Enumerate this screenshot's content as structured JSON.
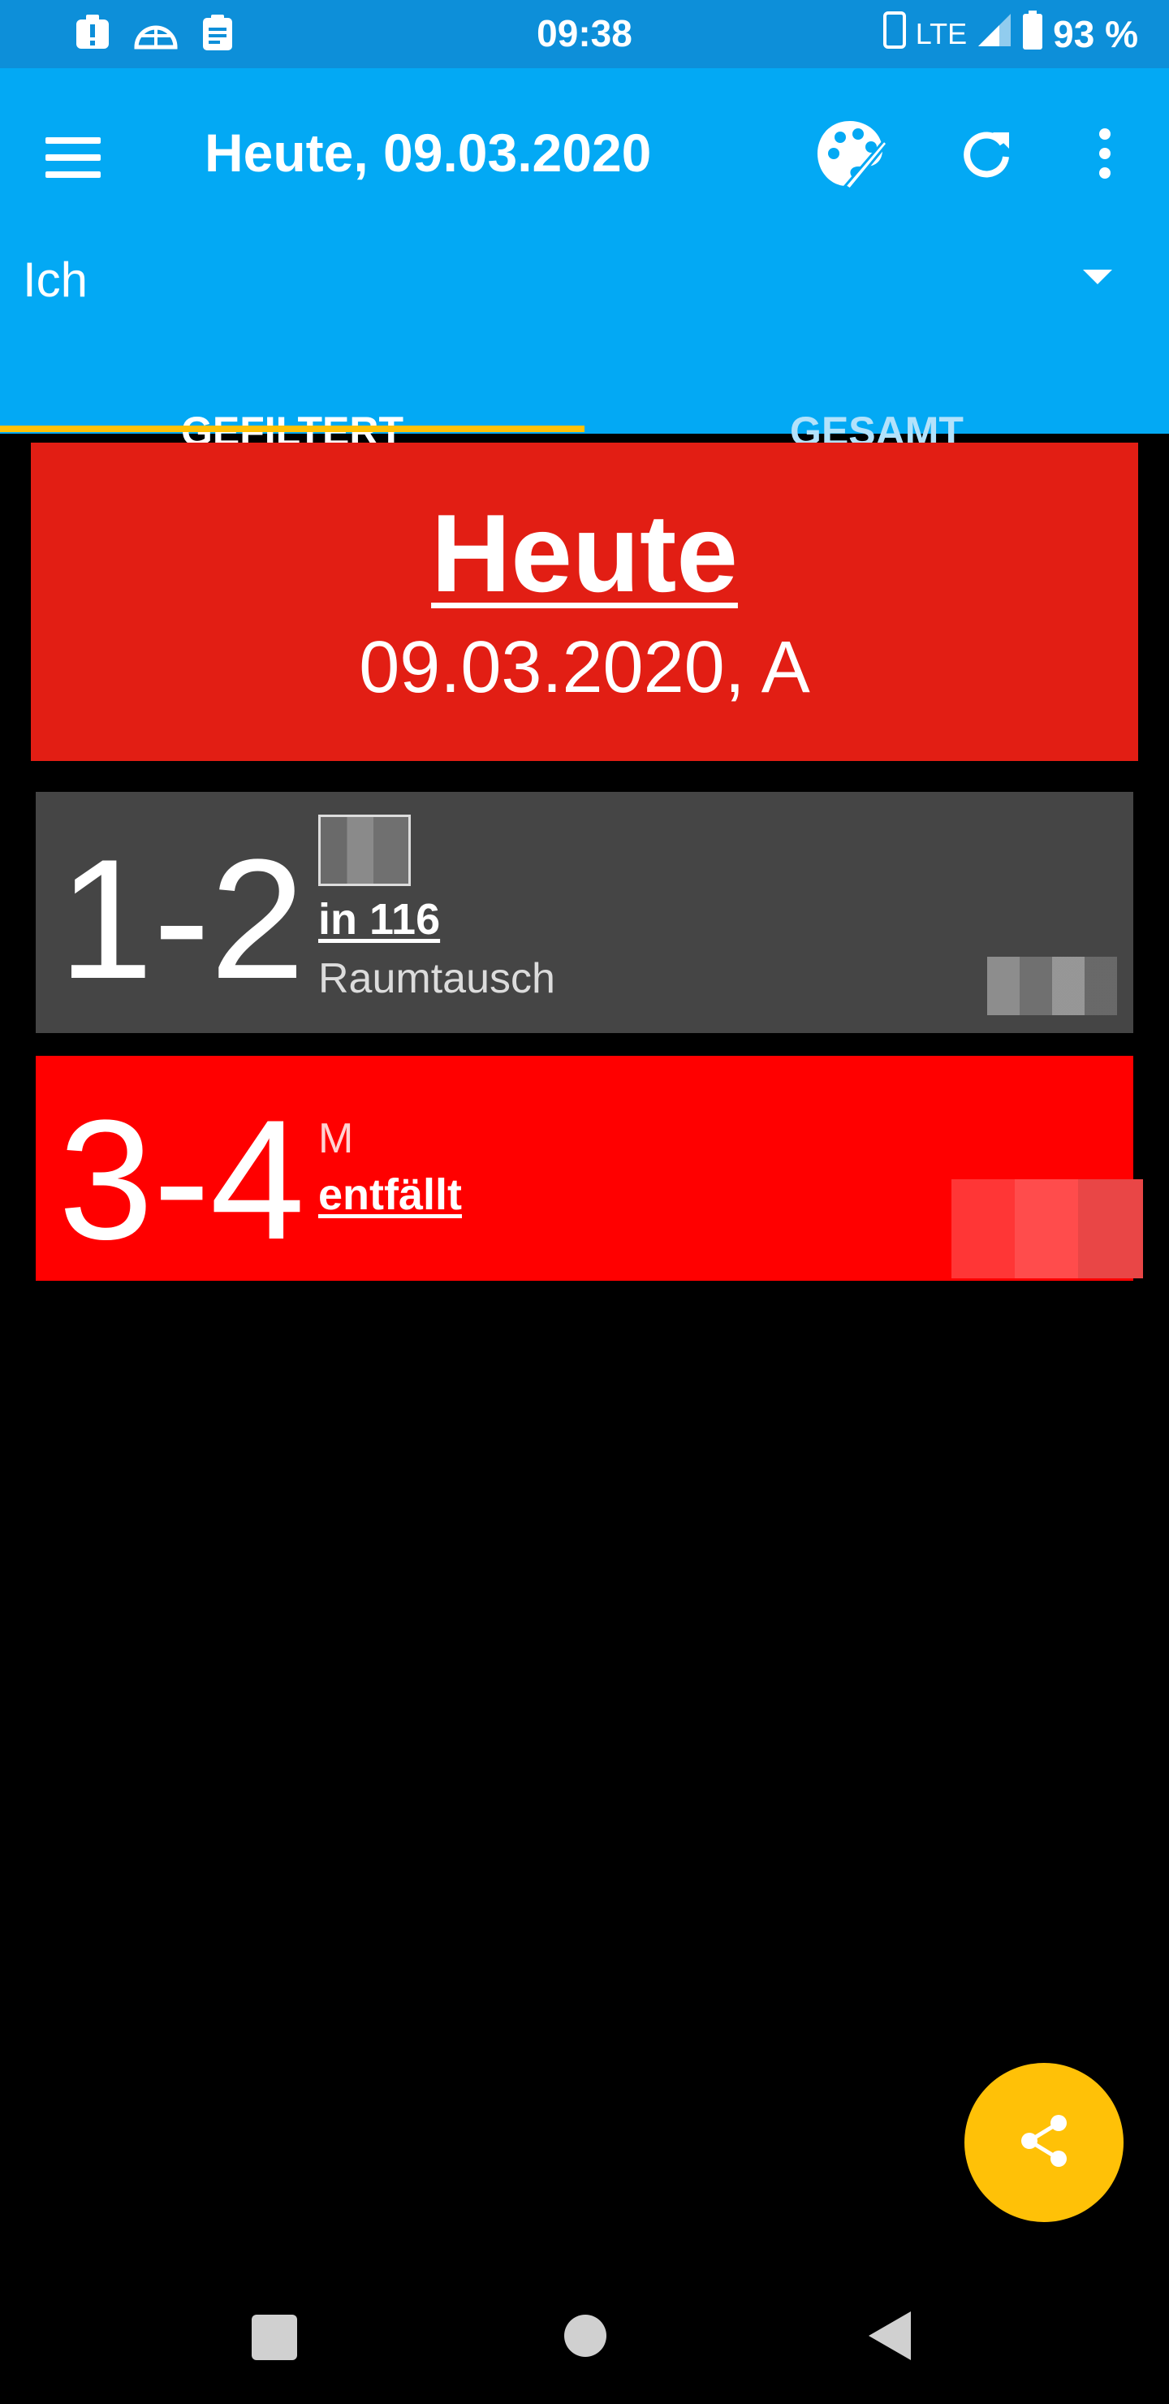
{
  "status_bar": {
    "time": "09:38",
    "network": "LTE",
    "battery": "93 %",
    "icons": [
      "alert-icon",
      "dome-icon",
      "clipboard-icon",
      "phone-icon",
      "signal-icon",
      "battery-icon"
    ]
  },
  "app_bar": {
    "title": "Heute, 09.03.2020",
    "actions": [
      "palette-icon",
      "refresh-icon",
      "more-vert-icon"
    ],
    "dropdown_value": "Ich",
    "tabs": [
      {
        "label": "GEFILTERT",
        "active": true
      },
      {
        "label": "GESAMT",
        "active": false
      }
    ]
  },
  "day": {
    "title": "Heute",
    "date": "09.03.2020, A",
    "color": "#e21e14"
  },
  "lessons": [
    {
      "hours": "1-2",
      "room": "in 116",
      "note": "Raumtausch",
      "color": "#454545"
    },
    {
      "hours": "3-4",
      "subject": "M",
      "status": "entfällt",
      "color": "#ff0000"
    }
  ],
  "colors": {
    "status_bar": "#0d8fd9",
    "app_bar": "#03a9f4",
    "accent": "#ffc107"
  },
  "fab": {
    "icon": "share-icon"
  },
  "nav": [
    "recents-icon",
    "home-icon",
    "back-icon"
  ]
}
